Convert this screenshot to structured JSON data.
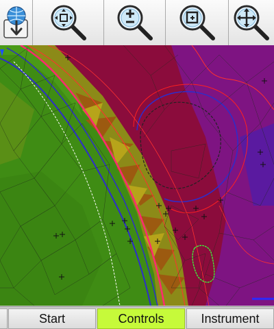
{
  "toolbar": {
    "buttons": [
      {
        "name": "download-map-button",
        "icon": "globe-download-icon"
      },
      {
        "name": "zoom-fit-button",
        "icon": "zoom-extents-icon"
      },
      {
        "name": "zoom-in-out-button",
        "icon": "zoom-plus-minus-icon"
      },
      {
        "name": "zoom-window-button",
        "icon": "zoom-window-icon"
      },
      {
        "name": "pan-button",
        "icon": "pan-arrows-icon"
      }
    ]
  },
  "tabs": [
    {
      "label": "Start",
      "active": false
    },
    {
      "label": "Controls",
      "active": true
    },
    {
      "label": "Instrument",
      "active": false
    }
  ],
  "colors": {
    "active_tab": "#c6fa3a",
    "terrain_green": "#3f8c14",
    "terrain_olive": "#8a8a1a",
    "terrain_crimson": "#8f0a3a",
    "terrain_purple": "#7a1a86",
    "breakline_red": "#ff2020",
    "boundary_blue": "#2d2dcc"
  }
}
